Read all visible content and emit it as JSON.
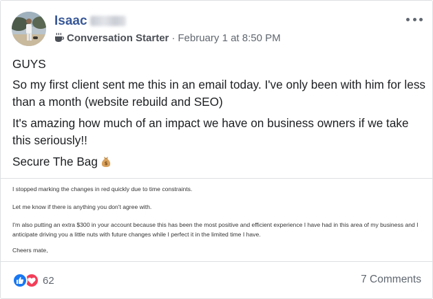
{
  "post": {
    "author": {
      "name": "Isaac"
    },
    "badge": {
      "icon": "coffee-cup-icon",
      "label": "Conversation Starter"
    },
    "separator": "·",
    "timestamp": "February 1 at 8:50 PM",
    "paragraphs": [
      "GUYS",
      "So my first client sent me this in an email today. I've only been with him for less than a month (website rebuild and SEO)",
      "It's amazing how much of an impact we have on business owners if we take this seriously!!",
      "Secure The Bag"
    ],
    "emoji": "money-bag-icon"
  },
  "attachment": {
    "lines": [
      "I stopped marking the changes in red quickly due to time constraints.",
      "Let me know if there is anything you don't agree with.",
      "I'm also putting an extra $300 in your account because this has been the most positive and efficient experience I have had in this area of my business and I anticipate driving you a little nuts with future changes while I perfect it in the limited time I have.",
      "Cheers mate,"
    ]
  },
  "footer": {
    "reaction_icons": [
      "like-icon",
      "love-icon"
    ],
    "reaction_count": "62",
    "comments_label": "7 Comments"
  },
  "colors": {
    "author_link": "#385898",
    "like": "#1877f2",
    "love": "#f33e58",
    "muted": "#606770"
  }
}
